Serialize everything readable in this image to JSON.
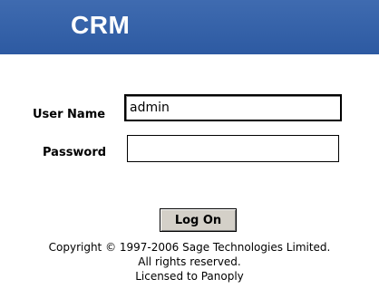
{
  "header": {
    "title": "CRM",
    "background_color": "#2f5ca4",
    "title_color": "#ffffff"
  },
  "login_form": {
    "username_label": "User Name",
    "username_value": "admin",
    "password_label": "Password",
    "password_value": "",
    "submit_label": "Log On"
  },
  "footer": {
    "copyright": "Copyright © 1997-2006 Sage Technologies Limited.",
    "rights": "All rights reserved.",
    "license": "Licensed to Panoply"
  }
}
